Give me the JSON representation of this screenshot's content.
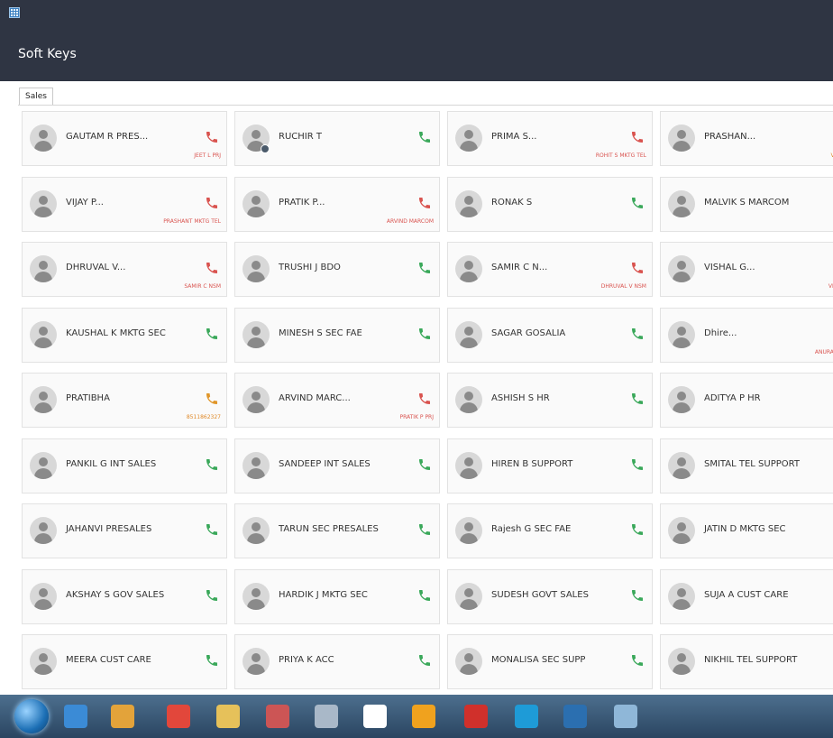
{
  "header": {
    "title": "Soft Keys"
  },
  "tabs": [
    {
      "label": "Sales"
    }
  ],
  "colors": {
    "chrome": "#2f3543",
    "call_green": "#3aa85a",
    "call_red": "#d9534f",
    "call_orange": "#e0962a"
  },
  "contacts": [
    [
      {
        "name": "GAUTAM R PRES...",
        "sub": "JEET L PRJ",
        "phone": "red"
      },
      {
        "name": "RUCHIR T",
        "sub": "",
        "phone": "green",
        "status": true
      },
      {
        "name": "PRIMA S...",
        "sub": "ROHIT S MKTG TEL",
        "phone": "red"
      },
      {
        "name": "PRASHAN...",
        "sub": "VIJAY P MA",
        "phone": "",
        "subcolor": "orange"
      }
    ],
    [
      {
        "name": "VIJAY P...",
        "sub": "PRASHANT MKTG TEL",
        "phone": "red"
      },
      {
        "name": "PRATIK P...",
        "sub": "ARVIND MARCOM",
        "phone": "red"
      },
      {
        "name": "RONAK S",
        "sub": "",
        "phone": "green"
      },
      {
        "name": "MALVIK S MARCOM",
        "sub": "",
        "phone": ""
      }
    ],
    [
      {
        "name": "DHRUVAL V...",
        "sub": "SAMIR C NSM",
        "phone": "red"
      },
      {
        "name": "TRUSHI J BDO",
        "sub": "",
        "phone": "green"
      },
      {
        "name": "SAMIR C N...",
        "sub": "DHRUVAL V NSM",
        "phone": "red"
      },
      {
        "name": "VISHAL G...",
        "sub": "VIHAR S PR",
        "phone": ""
      }
    ],
    [
      {
        "name": "KAUSHAL K MKTG SEC",
        "sub": "",
        "phone": "green"
      },
      {
        "name": "MINESH S SEC FAE",
        "sub": "",
        "phone": "green"
      },
      {
        "name": "SAGAR GOSALIA",
        "sub": "",
        "phone": "green"
      },
      {
        "name": "Dhire...",
        "sub": "ANURADHA J MA",
        "phone": ""
      }
    ],
    [
      {
        "name": "PRATIBHA",
        "sub": "8511862327",
        "phone": "orange",
        "subcolor": "orange"
      },
      {
        "name": "ARVIND MARC...",
        "sub": "PRATIK P PRJ",
        "phone": "red"
      },
      {
        "name": "ASHISH S HR",
        "sub": "",
        "phone": "green"
      },
      {
        "name": "ADITYA P HR",
        "sub": "",
        "phone": ""
      }
    ],
    [
      {
        "name": "PANKIL G INT SALES",
        "sub": "",
        "phone": "green"
      },
      {
        "name": "SANDEEP INT SALES",
        "sub": "",
        "phone": "green"
      },
      {
        "name": "HIREN B SUPPORT",
        "sub": "",
        "phone": "green"
      },
      {
        "name": "SMITAL TEL SUPPORT",
        "sub": "",
        "phone": ""
      }
    ],
    [
      {
        "name": "JAHANVI PRESALES",
        "sub": "",
        "phone": "green"
      },
      {
        "name": "TARUN SEC PRESALES",
        "sub": "",
        "phone": "green"
      },
      {
        "name": "Rajesh G SEC FAE",
        "sub": "",
        "phone": "green"
      },
      {
        "name": "JATIN D MKTG SEC",
        "sub": "",
        "phone": ""
      }
    ],
    [
      {
        "name": "AKSHAY S GOV SALES",
        "sub": "",
        "phone": "green"
      },
      {
        "name": "HARDIK J MKTG SEC",
        "sub": "",
        "phone": "green"
      },
      {
        "name": "SUDESH GOVT SALES",
        "sub": "",
        "phone": "green"
      },
      {
        "name": "SUJA A CUST CARE",
        "sub": "",
        "phone": ""
      }
    ],
    [
      {
        "name": "MEERA CUST CARE",
        "sub": "",
        "phone": "green"
      },
      {
        "name": "PRIYA K ACC",
        "sub": "",
        "phone": "green"
      },
      {
        "name": "MONALISA SEC SUPP",
        "sub": "",
        "phone": "green"
      },
      {
        "name": "NIKHIL TEL SUPPORT",
        "sub": "",
        "phone": ""
      }
    ]
  ],
  "taskbar": [
    {
      "name": "ie-icon",
      "color": "#3b8bd6"
    },
    {
      "name": "media-player-icon",
      "color": "#e3a33a"
    },
    {
      "name": "chrome-icon",
      "color": "#e2473b"
    },
    {
      "name": "file-explorer-icon",
      "color": "#e6c15a"
    },
    {
      "name": "snipping-tool-icon",
      "color": "#cc5555"
    },
    {
      "name": "calculator-icon",
      "color": "#a9b8c8"
    },
    {
      "name": "app-bolt-icon",
      "color": "#ffffff"
    },
    {
      "name": "outlook-icon",
      "color": "#f0a21e"
    },
    {
      "name": "acrobat-icon",
      "color": "#d0302b"
    },
    {
      "name": "skype-icon",
      "color": "#1e9bd7"
    },
    {
      "name": "softkeys-icon",
      "color": "#2b6fb0"
    },
    {
      "name": "paint-icon",
      "color": "#8fb7d8"
    }
  ]
}
